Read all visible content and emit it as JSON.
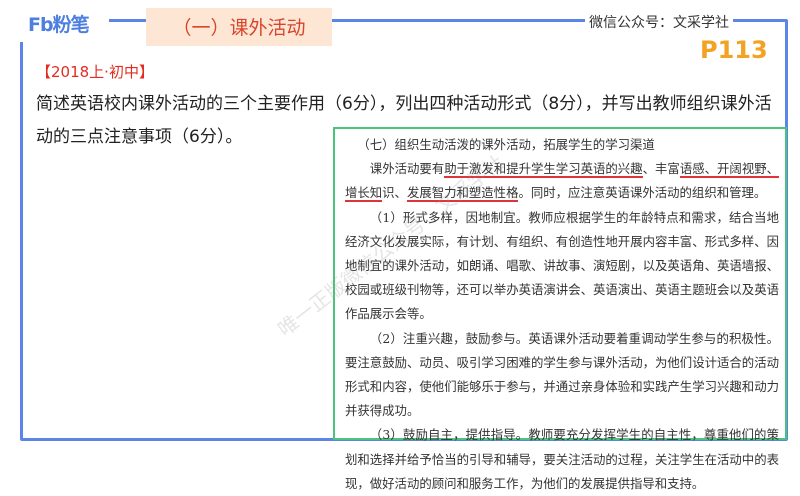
{
  "header": {
    "logo": "Fb粉笔",
    "section_title": "（一）课外活动",
    "wechat": "微信公众号：文采学社",
    "page": "P113"
  },
  "question": {
    "tag": "【2018上·初中】",
    "text": "简述英语校内课外活动的三个主要作用（6分），列出四种活动形式（8分），并写出教师组织课外活动的三点注意事项（6分）。"
  },
  "book": {
    "heading": "（七）组织生动活泼的课外活动，拓展学生的学习渠道",
    "p1": [
      "课外活动要有",
      "助于激发和提升学生学习英语的兴趣",
      "、丰富",
      "语感、开阔视野、增长知",
      "识、",
      "发展智力和塑造性格",
      "。同时，应注意英语课外活动的组织和管理。"
    ],
    "p2": "（1）形式多样，因地制宜。教师应根据学生的年龄特点和需求，结合当地经济文化发展实际，有计划、有组织、有创造性地开展内容丰富、形式多样、因地制宜的课外活动，如朗诵、唱歌、讲故事、演短剧，以及英语角、英语墙报、校园或班级刊物等，还可以举办英语演讲会、英语演出、英语主题班会以及英语作品展示会等。",
    "p3": "（2）注重兴趣，鼓励参与。英语课外活动要着重调动学生参与的积极性。要注意鼓励、动员、吸引学习困难的学生参与课外活动，为他们设计适合的活动形式和内容，使他们能够乐于参与，并通过亲身体验和实践产生学习兴趣和动力并获得成功。",
    "p4": "（3）鼓励自主，提供指导。教师要充分发挥学生的自主性，尊重他们的策划和选择并给予恰当的引导和辅导，要关注活动的过程，关注学生在活动中的表现，做好活动的顾问和服务工作，为他们的发展提供指导和支持。"
  },
  "watermark": "唯一正版微信公众号：文采学社"
}
